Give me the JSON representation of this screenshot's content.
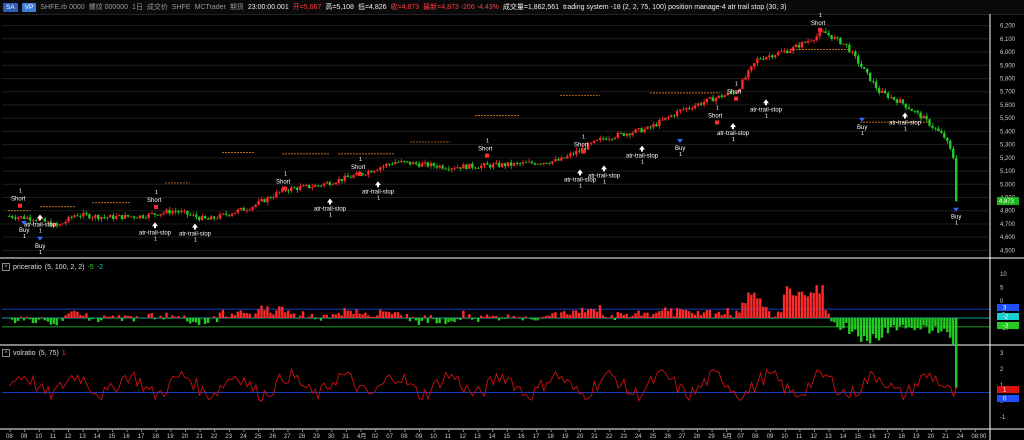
{
  "header": {
    "symbol_badge": "SA",
    "flag_badge": "VP",
    "symbol": "SHFE.rb 0000",
    "symbol_cn": "螺纹 000000",
    "interval": "1日",
    "volume_label": "成交价",
    "exchange": "SHFE",
    "feed": "MCTrader",
    "tz_label": "期货",
    "time": "23:00:00.001",
    "open": "开=5,667",
    "high": "高=5,108",
    "low": "低=4,826",
    "close": "收=4,873",
    "change": "最新=4,873 -206 -4.43%",
    "volume": "成交量=1,862,561",
    "strategy": "trading system -18 (2, 2, 75, 100) position manage-4 atr trail stop (30, 3)"
  },
  "price_axis": {
    "labels": [
      "6,200",
      "6,100",
      "6,000",
      "5,900",
      "5,800",
      "5,700",
      "5,600",
      "5,500",
      "5,400",
      "5,300",
      "5,200",
      "5,100",
      "5,000",
      "4,900",
      "4,800",
      "4,700",
      "4,600",
      "4,500"
    ],
    "current_badge": "4,873"
  },
  "price_ratio_pane": {
    "name": "priceratio",
    "params": "(5, 100, 2, 2)",
    "v1": "-5",
    "v2": "-2",
    "axis": [
      "10",
      "5",
      "0",
      "-5",
      "-10"
    ],
    "badges": [
      "3",
      "-2",
      "-3"
    ]
  },
  "volratio_pane": {
    "name": "volratio",
    "params": "(5, 75)",
    "v1": "1",
    "axis": [
      "3",
      "2",
      "1",
      "0",
      "-1"
    ],
    "badges": [
      "1",
      "0"
    ]
  },
  "time_axis": {
    "labels": [
      "08",
      "09",
      "10",
      "11",
      "12",
      "13",
      "14",
      "15",
      "16",
      "17",
      "18",
      "19",
      "20",
      "21",
      "22",
      "23",
      "24",
      "25",
      "26",
      "27",
      "28",
      "29",
      "30",
      "31",
      "4月",
      "02",
      "07",
      "08",
      "09",
      "10",
      "11",
      "12",
      "13",
      "14",
      "15",
      "16",
      "17",
      "18",
      "19",
      "20",
      "21",
      "22",
      "23",
      "24",
      "25",
      "26",
      "27",
      "28",
      "29",
      "5月",
      "07",
      "08",
      "09",
      "10",
      "11",
      "12",
      "13",
      "14",
      "15",
      "16",
      "17",
      "18",
      "19",
      "20",
      "21",
      "24",
      "08:00"
    ]
  },
  "chart_data": [
    {
      "type": "candlestick",
      "title": "",
      "price_range": [
        4500,
        6200
      ],
      "last_price": 4873,
      "signals": [
        {
          "label": "Short",
          "qty": "1"
        },
        {
          "label": "atr-trail-stop",
          "qty": "1"
        },
        {
          "label": "Buy",
          "qty": "1"
        },
        {
          "label": "Buy",
          "qty": "1"
        },
        {
          "label": "Short",
          "qty": "1"
        },
        {
          "label": "atr-trail-stop",
          "qty": "1"
        },
        {
          "label": "atr-trail-stop",
          "qty": "1"
        },
        {
          "label": "Short",
          "qty": "1"
        },
        {
          "label": "atr-trail-stop",
          "qty": "1"
        },
        {
          "label": "Short",
          "qty": "1"
        },
        {
          "label": "atr-trail-stop",
          "qty": "1"
        },
        {
          "label": "Short",
          "qty": "1"
        },
        {
          "label": "atr-trail-stop",
          "qty": "1"
        },
        {
          "label": "atr-trail-stop",
          "qty": "1"
        },
        {
          "label": "Short",
          "qty": "1"
        },
        {
          "label": "atr-trail-stop",
          "qty": "1"
        },
        {
          "label": "Buy",
          "qty": "1"
        },
        {
          "label": "Short",
          "qty": "1"
        },
        {
          "label": "atr-trail-stop",
          "qty": "1"
        },
        {
          "label": "Short",
          "qty": "1"
        },
        {
          "label": "atr-trail-stop",
          "qty": "1"
        },
        {
          "label": "Short",
          "qty": "1"
        },
        {
          "label": "Buy",
          "qty": "1"
        },
        {
          "label": "atr-trail-stop",
          "qty": "1"
        },
        {
          "label": "Buy",
          "qty": "1"
        }
      ]
    },
    {
      "type": "bar",
      "title": "",
      "ylim": [
        -10,
        10
      ]
    },
    {
      "type": "line",
      "title": "",
      "ylim": [
        -1,
        3
      ]
    }
  ],
  "colors": {
    "up": "#ff2a2a",
    "down": "#22cc22",
    "grid": "#1e1e1e",
    "level": "#1f4fff",
    "zero": "#19d0d0",
    "vol": "#cc1111"
  }
}
